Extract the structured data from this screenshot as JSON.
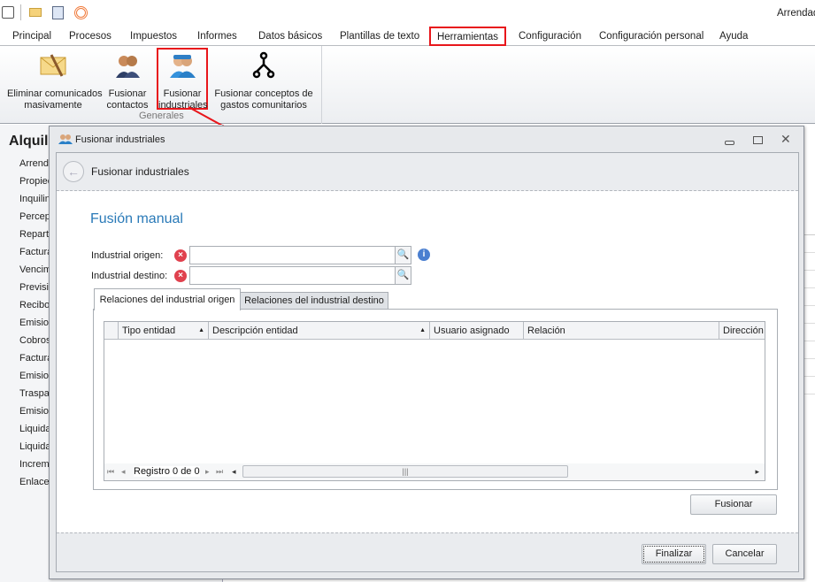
{
  "app": {
    "user_label": "Arrendad"
  },
  "ribbon_tabs": [
    "Principal",
    "Procesos",
    "Impuestos",
    "Informes",
    "Datos básicos",
    "Plantillas de texto",
    "Herramientas",
    "Configuración",
    "Configuración personal",
    "Ayuda"
  ],
  "ribbon": {
    "buttons": [
      {
        "l1": "Eliminar comunicados",
        "l2": "masivamente"
      },
      {
        "l1": "Fusionar",
        "l2": "contactos"
      },
      {
        "l1": "Fusionar",
        "l2": "industriales"
      },
      {
        "l1": "Fusionar conceptos de",
        "l2": "gastos comunitarios"
      }
    ],
    "group": "Generales"
  },
  "sidebar": {
    "title": "Alquil",
    "items": [
      "Arrend",
      "Propiec",
      "Inquilin",
      "Percep",
      "Repart",
      "Factura",
      "Vencim",
      "Previsi",
      "Recibo",
      "Emision",
      "Cobros",
      "Factura",
      "Emision",
      "Traspa",
      "Emision",
      "Liquida",
      "Liquida",
      "Increm",
      "Enlaces"
    ]
  },
  "dialog": {
    "title": "Fusionar industriales",
    "header": "Fusionar industriales",
    "section": "Fusión manual",
    "origin_label": "Industrial origen:",
    "origin_value": "",
    "dest_label": "Industrial destino:",
    "dest_value": "",
    "tabs": [
      "Relaciones del industrial origen",
      "Relaciones del industrial destino"
    ],
    "columns": [
      "Tipo entidad",
      "Descripción entidad",
      "Usuario asignado",
      "Relación",
      "Dirección"
    ],
    "nav": "Registro 0 de 0",
    "fusionar": "Fusionar",
    "finalizar": "Finalizar",
    "cancelar": "Cancelar"
  },
  "colors": {
    "highlight": "#e8161b",
    "accent": "#2a7ab8"
  }
}
